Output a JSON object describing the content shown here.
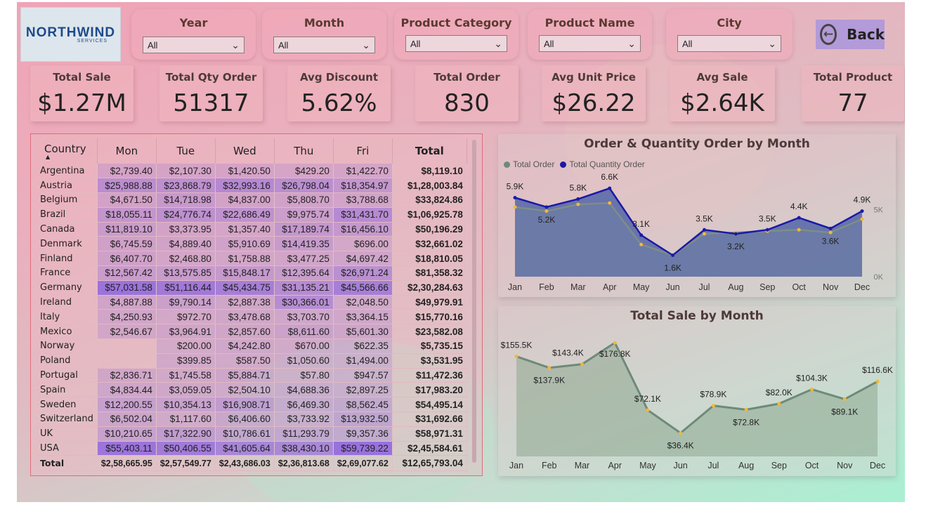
{
  "logo": {
    "main": "NORTHWIND",
    "sub": "SERVICES"
  },
  "filters": [
    {
      "label": "Year",
      "value": "All"
    },
    {
      "label": "Month",
      "value": "All"
    },
    {
      "label": "Product Category",
      "value": "All"
    },
    {
      "label": "Product Name",
      "value": "All"
    },
    {
      "label": "City",
      "value": "All"
    }
  ],
  "back_label": "Back",
  "kpis": [
    {
      "title": "Total Sale",
      "value": "$1.27M"
    },
    {
      "title": "Total Qty Order",
      "value": "51317"
    },
    {
      "title": "Avg Discount",
      "value": "5.62%"
    },
    {
      "title": "Total Order",
      "value": "830"
    },
    {
      "title": "Avg Unit Price",
      "value": "$26.22"
    },
    {
      "title": "Avg Sale",
      "value": "$2.64K"
    },
    {
      "title": "Total Product",
      "value": "77"
    }
  ],
  "table": {
    "headers": [
      "Country",
      "Mon",
      "Tue",
      "Wed",
      "Thu",
      "Fri",
      "Total"
    ],
    "rows": [
      [
        "Argentina",
        "$2,739.40",
        "$2,107.30",
        "$1,420.50",
        "$429.20",
        "$1,422.70",
        "$8,119.10"
      ],
      [
        "Austria",
        "$25,988.88",
        "$23,868.79",
        "$32,993.16",
        "$26,798.04",
        "$18,354.97",
        "$1,28,003.84"
      ],
      [
        "Belgium",
        "$4,671.50",
        "$14,718.98",
        "$4,837.00",
        "$5,808.70",
        "$3,788.68",
        "$33,824.86"
      ],
      [
        "Brazil",
        "$18,055.11",
        "$24,776.74",
        "$22,686.49",
        "$9,975.74",
        "$31,431.70",
        "$1,06,925.78"
      ],
      [
        "Canada",
        "$11,819.10",
        "$3,373.95",
        "$1,357.40",
        "$17,189.74",
        "$16,456.10",
        "$50,196.29"
      ],
      [
        "Denmark",
        "$6,745.59",
        "$4,889.40",
        "$5,910.69",
        "$14,419.35",
        "$696.00",
        "$32,661.02"
      ],
      [
        "Finland",
        "$6,407.70",
        "$2,468.80",
        "$1,758.88",
        "$3,477.25",
        "$4,697.42",
        "$18,810.05"
      ],
      [
        "France",
        "$12,567.42",
        "$13,575.85",
        "$15,848.17",
        "$12,395.64",
        "$26,971.24",
        "$81,358.32"
      ],
      [
        "Germany",
        "$57,031.58",
        "$51,116.44",
        "$45,434.75",
        "$31,135.21",
        "$45,566.66",
        "$2,30,284.63"
      ],
      [
        "Ireland",
        "$4,887.88",
        "$9,790.14",
        "$2,887.38",
        "$30,366.01",
        "$2,048.50",
        "$49,979.91"
      ],
      [
        "Italy",
        "$4,250.93",
        "$972.70",
        "$3,478.68",
        "$3,703.70",
        "$3,364.15",
        "$15,770.16"
      ],
      [
        "Mexico",
        "$2,546.67",
        "$3,964.91",
        "$2,857.60",
        "$8,611.60",
        "$5,601.30",
        "$23,582.08"
      ],
      [
        "Norway",
        "",
        "$200.00",
        "$4,242.80",
        "$670.00",
        "$622.35",
        "$5,735.15"
      ],
      [
        "Poland",
        "",
        "$399.85",
        "$587.50",
        "$1,050.60",
        "$1,494.00",
        "$3,531.95"
      ],
      [
        "Portugal",
        "$2,836.71",
        "$1,745.58",
        "$5,884.71",
        "$57.80",
        "$947.57",
        "$11,472.36"
      ],
      [
        "Spain",
        "$4,834.44",
        "$3,059.05",
        "$2,504.10",
        "$4,688.36",
        "$2,897.25",
        "$17,983.20"
      ],
      [
        "Sweden",
        "$12,200.55",
        "$10,354.13",
        "$16,908.71",
        "$6,469.30",
        "$8,562.45",
        "$54,495.14"
      ],
      [
        "Switzerland",
        "$6,502.04",
        "$1,117.60",
        "$6,406.60",
        "$3,733.92",
        "$13,932.50",
        "$31,692.66"
      ],
      [
        "UK",
        "$10,210.65",
        "$17,322.90",
        "$10,786.61",
        "$11,293.79",
        "$9,357.36",
        "$58,971.31"
      ],
      [
        "USA",
        "$55,403.11",
        "$50,406.55",
        "$41,605.64",
        "$38,430.10",
        "$59,739.22",
        "$2,45,584.61"
      ]
    ],
    "total": [
      "Total",
      "$2,58,665.95",
      "$2,57,549.77",
      "$2,43,686.03",
      "$2,36,813.68",
      "$2,69,077.62",
      "$12,65,793.04"
    ]
  },
  "chart_data": [
    {
      "type": "area",
      "title": "Order & Quantity Order by Month",
      "categories": [
        "Jan",
        "Feb",
        "Mar",
        "Apr",
        "May",
        "Jun",
        "Jul",
        "Aug",
        "Sep",
        "Oct",
        "Nov",
        "Dec"
      ],
      "series": [
        {
          "name": "Total Order",
          "color": "#6e8a78",
          "values": [
            5.2,
            4.9,
            5.4,
            5.5,
            2.4,
            1.6,
            3.2,
            3.3,
            3.4,
            3.5,
            3.3,
            4.3
          ]
        },
        {
          "name": "Total Quantity Order",
          "color": "#1a1aa6",
          "values": [
            5.9,
            5.2,
            5.8,
            6.6,
            3.1,
            1.6,
            3.5,
            3.2,
            3.5,
            4.4,
            3.6,
            4.9
          ]
        }
      ],
      "data_labels": [
        "5.9K",
        "5.2K",
        "5.8K",
        "6.6K",
        "3.1K",
        "1.6K",
        "3.5K",
        "3.2K",
        "3.5K",
        "4.4K",
        "3.6K",
        "4.9K"
      ],
      "y_ticks": [
        "5K",
        "0K"
      ],
      "ylim": [
        0,
        7.5
      ],
      "legend": "top-left"
    },
    {
      "type": "area",
      "title": "Total Sale by Month",
      "categories": [
        "Jan",
        "Feb",
        "Mar",
        "Apr",
        "May",
        "Jun",
        "Jul",
        "Aug",
        "Sep",
        "Oct",
        "Nov",
        "Dec"
      ],
      "series": [
        {
          "name": "Total Sale",
          "color": "#6e8a78",
          "values": [
            155.5,
            137.9,
            143.4,
            176.8,
            72.1,
            36.4,
            78.9,
            72.8,
            82.0,
            104.3,
            89.1,
            116.6
          ]
        }
      ],
      "data_labels": [
        "$155.5K",
        "$137.9K",
        "$143.4K",
        "$176.8K",
        "$72.1K",
        "$36.4K",
        "$78.9K",
        "$72.8K",
        "$82.0K",
        "$104.3K",
        "$89.1K",
        "$116.6K"
      ],
      "ylim": [
        0,
        190
      ]
    }
  ]
}
